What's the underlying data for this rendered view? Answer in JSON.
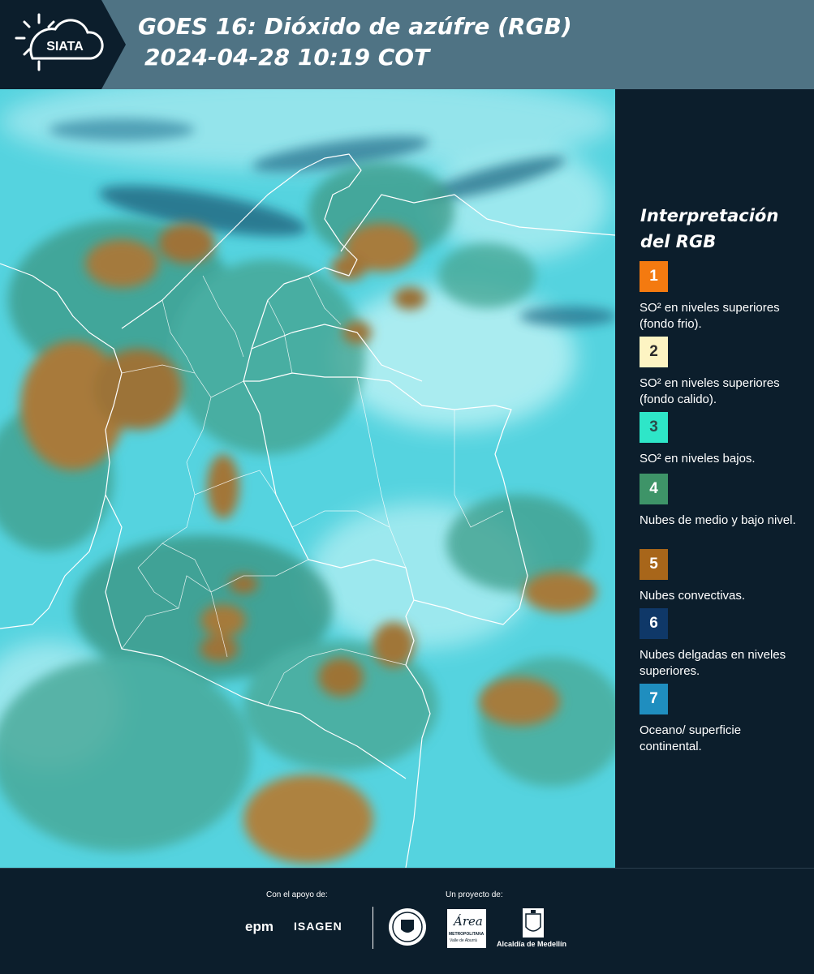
{
  "header": {
    "logo_text": "SIATA",
    "title_line1": "GOES 16: Dióxido de azúfre (RGB)",
    "title_line2": "2024-04-28 10:19 COT"
  },
  "legend": {
    "title_line1": "Interpretación",
    "title_line2": "del RGB",
    "items": [
      {
        "number": "1",
        "color": "#f47a10",
        "label": "SO² en niveles superiores (fondo frio)."
      },
      {
        "number": "2",
        "color": "#fdf4c3",
        "label": "SO² en niveles superiores (fondo calido)."
      },
      {
        "number": "3",
        "color": "#2ee6c8",
        "label": "SO² en niveles bajos."
      },
      {
        "number": "4",
        "color": "#3e9468",
        "label": "Nubes de medio y bajo nivel."
      },
      {
        "number": "5",
        "color": "#a8661a",
        "label": "Nubes convectivas."
      },
      {
        "number": "6",
        "color": "#0f3868",
        "label": "Nubes delgadas en niveles superiores."
      },
      {
        "number": "7",
        "color": "#1f8ebf",
        "label": "Oceano/ superficie continental."
      }
    ]
  },
  "footer": {
    "support_label": "Con el apoyo de:",
    "project_label": "Un proyecto de:",
    "sponsor1": "epm",
    "sponsor2": "ISAGEN",
    "partner_area_name": "Área",
    "partner_area_sub1": "METROPOLITANA",
    "partner_area_sub2": "Valle de Aburrá",
    "partner_city": "Alcaldía de Medellín"
  }
}
